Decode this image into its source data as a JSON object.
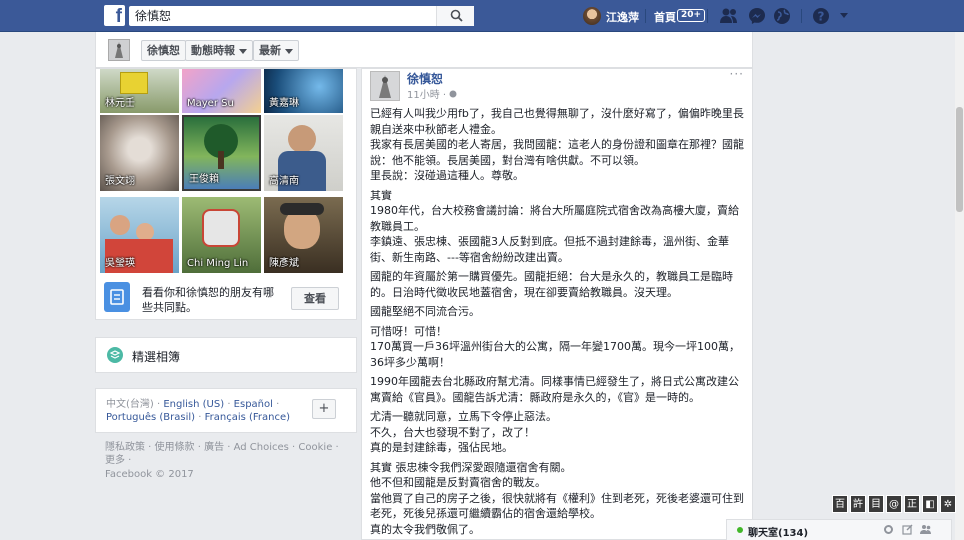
{
  "topbar": {
    "search_value": "徐慎恕",
    "user_name": "江逸萍",
    "home_label": "首頁",
    "home_badge": "20+"
  },
  "profile_strip": {
    "name_button": "徐慎恕",
    "timeline_button": "動態時報",
    "latest_button": "最新"
  },
  "friends": [
    {
      "name": "林元壬"
    },
    {
      "name": "Mayer Su"
    },
    {
      "name": "黃嘉琳"
    },
    {
      "name": "張文翊"
    },
    {
      "name": "王俊賴"
    },
    {
      "name": "高清南"
    },
    {
      "name": "吳瑩瑛"
    },
    {
      "name": "Chi Ming Lin"
    },
    {
      "name": "陳彥斌"
    }
  ],
  "mutual": {
    "text": "看看你和徐慎恕的朋友有哪些共同點。",
    "button": "查看"
  },
  "album": {
    "label": "精選相簿"
  },
  "languages": {
    "current": "中文(台灣)",
    "links": [
      "English (US)",
      "Español",
      "Português (Brasil)",
      "Français (France)"
    ],
    "plus": "+"
  },
  "footer": {
    "links": "隱私政策 · 使用條款 · 廣告 · Ad Choices · Cookie · 更多 ·",
    "copyright": "Facebook © 2017"
  },
  "post": {
    "author": "徐慎恕",
    "time": "11小時 · ",
    "more": "···",
    "paragraphs": [
      "已經有人叫我少用fb了，我自己也覺得無聊了，沒什麼好寫了，偏偏昨晚里長親自送來中秋節老人禮金。\n我家有長居美國的老人寄居，我問國龍：這老人的身份證和圖章在那裡？國龍說：他不能領。長居美國，對台灣有啥供獻。不可以領。\n里長說：沒碰過這種人。尊敬。",
      "其實\n1980年代，台大校務會議討論：將台大所屬庭院式宿舍改為高樓大廈，賣給教職員工。\n李鎮遠、張忠棟、張國龍3人反對到底。但抵不過封建餘毒，溫州街、金華街、新生南路、---等宿舍紛紛改建出賣。",
      "國龍的年資屬於第一購買優先。國龍拒絕：台大是永久的，教職員工是臨時的。日治時代徵收民地蓋宿舍，現在卻要賣給教職員。沒天理。",
      "國龍堅絕不同流合污。",
      "可惜呀！可惜！\n170萬買一戶36坪溫州街台大的公寓，隔一年變1700萬。現今一坪100萬，36坪多少萬啊！",
      "1990年國龍去台北縣政府幫尤清。同樣事情已經發生了，將日式公寓改建公寓賣給《官員》。國龍告訴尤清：縣政府是永久的，《官》是一時的。",
      "尤清一聽就同意，立馬下令停止惡法。\n不久，台大也發現不對了，改了！\n真的是封建餘毒，强佔民地。",
      "其實 張忠棟令我們深愛跟隨還宿舍有關。\n他不但和國龍是反對賣宿舍的戰友。\n當他買了自己的房子之後，很快就將有《權利》住到老死，死後老婆還可住到老死，死後兒孫還可繼續霸佔的宿舍還給學校。\n真的太令我們敬佩了。"
    ]
  },
  "chat": {
    "label": "聊天室(134)"
  },
  "ime_keys": [
    "百",
    "許",
    "目",
    "@",
    "正",
    "◧",
    "✲"
  ]
}
